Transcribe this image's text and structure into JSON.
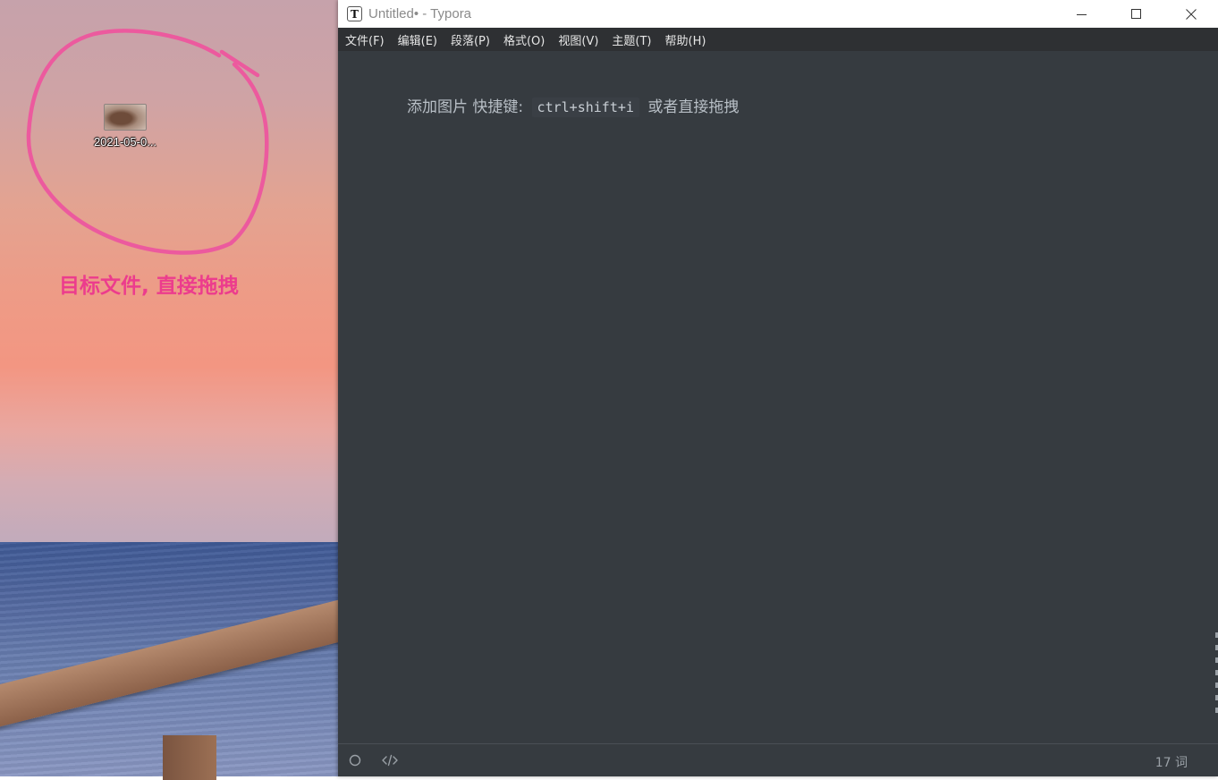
{
  "desktop": {
    "file_icon": {
      "label": "2021-05-0..."
    },
    "annotation": "目标文件, 直接拖拽",
    "annotation_color": "#ec3c8d"
  },
  "window": {
    "title": "Untitled• - Typora",
    "app_icon_letter": "T",
    "controls": [
      "minimize-icon",
      "maximize-icon",
      "close-icon"
    ]
  },
  "menubar": {
    "items": [
      {
        "label": "文件(F)"
      },
      {
        "label": "编辑(E)"
      },
      {
        "label": "段落(P)"
      },
      {
        "label": "格式(O)"
      },
      {
        "label": "视图(V)"
      },
      {
        "label": "主题(T)"
      },
      {
        "label": "帮助(H)"
      }
    ]
  },
  "editor": {
    "text_before": "添加图片 快捷键: ",
    "code": "ctrl+shift+i",
    "text_after": " 或者直接拖拽"
  },
  "statusbar": {
    "outline_icon": "circle-icon",
    "source_icon": "code-icon",
    "word_count": "17 词"
  },
  "colors": {
    "editor_bg": "#363b40",
    "menubar_bg": "#2e3033",
    "editor_text": "#b8bfc6"
  }
}
